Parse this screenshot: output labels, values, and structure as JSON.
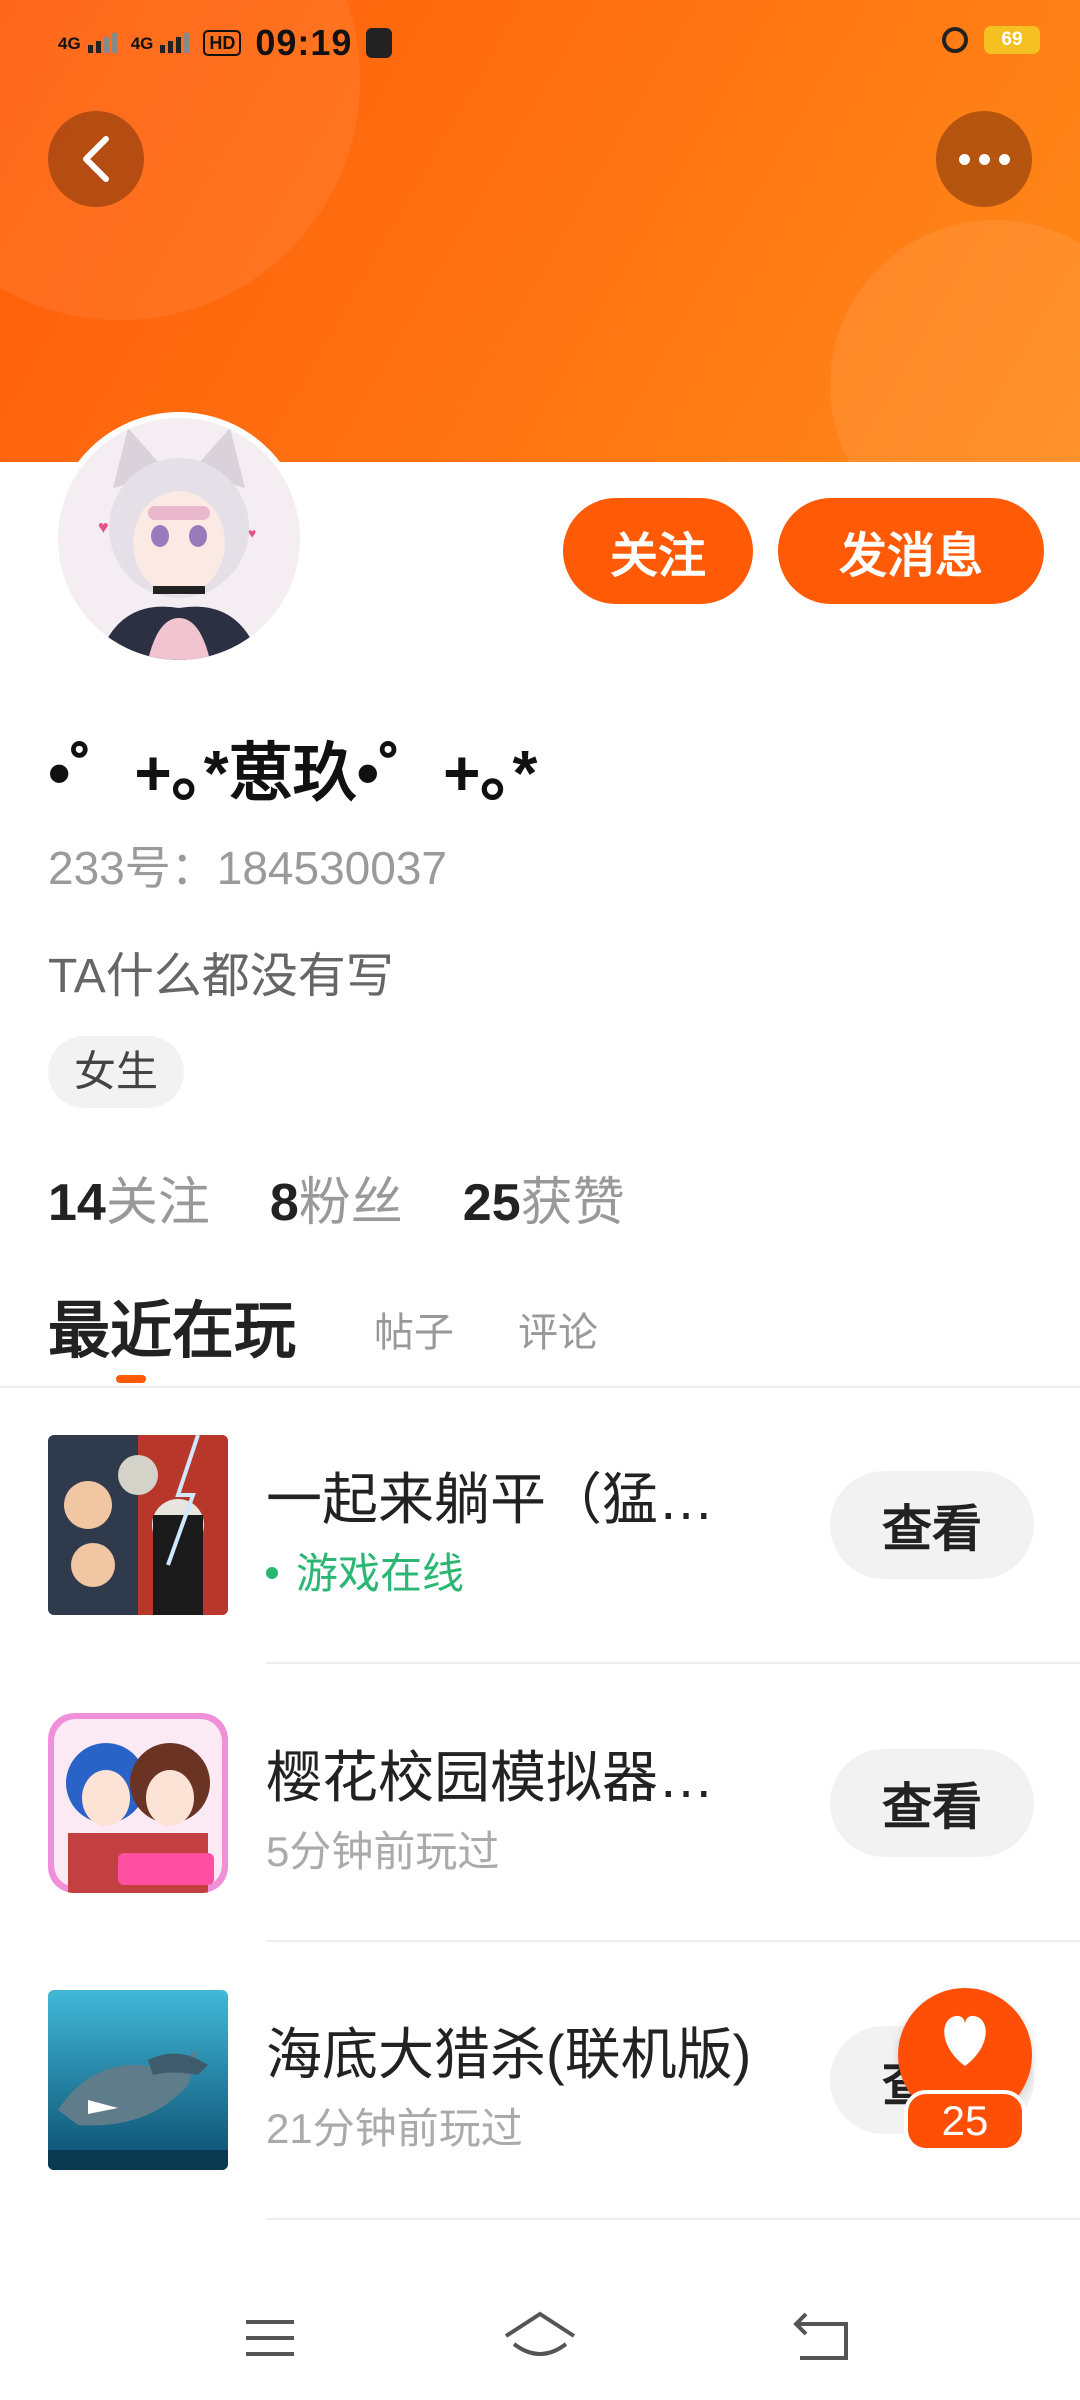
{
  "status_bar": {
    "network_1": "4G",
    "network_2": "4G",
    "hd_label": "HD",
    "time": "09:19",
    "battery": "69"
  },
  "header": {
    "back_icon": "chevron-left-icon",
    "more_icon": "more-horizontal-icon"
  },
  "profile": {
    "username": "•゜+｡*葸玖•゜+｡*",
    "user_id": "233号：184530037",
    "bio": "TA什么都没有写",
    "gender_tag": "女生",
    "follow_button": "关注",
    "message_button": "发消息",
    "stats": [
      {
        "count": "14",
        "label": "关注"
      },
      {
        "count": "8",
        "label": "粉丝"
      },
      {
        "count": "25",
        "label": "获赞"
      }
    ]
  },
  "tabs": {
    "active": "最近在玩",
    "posts": "帖子",
    "comments": "评论"
  },
  "games": [
    {
      "title": "一起来躺平（猛…",
      "status": "游戏在线",
      "online": true,
      "button": "查看"
    },
    {
      "title": "樱花校园模拟器…",
      "status": "5分钟前玩过",
      "online": false,
      "button": "查看"
    },
    {
      "title": "海底大猎杀(联机版)",
      "status": "21分钟前玩过",
      "online": false,
      "button": "查看"
    }
  ],
  "like_fab": {
    "icon": "heart-icon",
    "count": "25"
  },
  "nav_bar": {
    "menu_icon": "menu-icon",
    "home_icon": "home-icon",
    "back_icon": "back-icon"
  },
  "colors": {
    "accent": "#ff5a05",
    "online": "#2bb673"
  }
}
